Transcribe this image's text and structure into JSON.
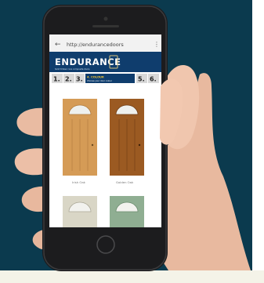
{
  "browser": {
    "url": "http://endurancedoors"
  },
  "brand": {
    "logo_text": "ENDURANCE",
    "tagline": "Solid timber core composite doors"
  },
  "steps": {
    "items": [
      "1.",
      "2.",
      "3.",
      "5.",
      "6."
    ],
    "active_title": "4. COLOUR",
    "active_subtitle": "Choose your door colour"
  },
  "doors": [
    {
      "label": "Irish Oak",
      "color": "#d59b56"
    },
    {
      "label": "Golden Oak",
      "color": "#9b5a22"
    },
    {
      "label": "",
      "color": "#d9d6c6"
    },
    {
      "label": "",
      "color": "#8fae92"
    }
  ],
  "colors": {
    "background": "#0b3a4e",
    "brand_blue": "#0f3d6d",
    "step_active": "#f1c232"
  }
}
